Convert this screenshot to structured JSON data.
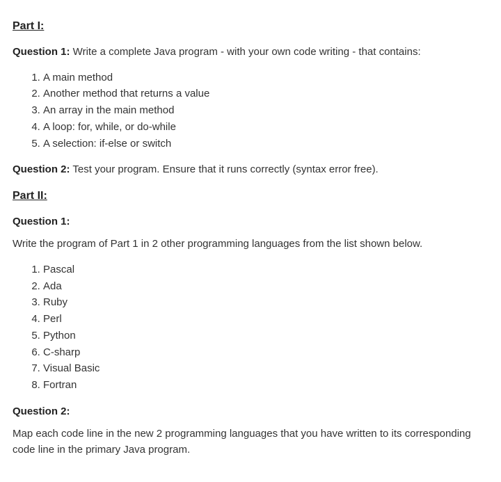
{
  "part1": {
    "heading": "Part I:",
    "q1": {
      "label": "Question 1:",
      "text": " Write a complete Java program - with your own code writing - that contains:",
      "items": [
        "A main method",
        "Another method that returns a value",
        "An array in the main method",
        "A loop: for, while, or do-while",
        "A selection: if-else or switch"
      ]
    },
    "q2": {
      "label": "Question 2:",
      "text": " Test your program. Ensure that it runs correctly (syntax error free)."
    }
  },
  "part2": {
    "heading": "Part II:",
    "q1": {
      "label": "Question 1:",
      "text": "Write the program of Part 1 in 2 other programming languages from the list shown below.",
      "items": [
        "Pascal",
        "Ada",
        "Ruby",
        "Perl",
        "Python",
        "C-sharp",
        "Visual Basic",
        "Fortran"
      ]
    },
    "q2": {
      "label": "Question 2:",
      "text": "Map each code line in the new 2 programming languages that you have written to its corresponding code line in the primary Java program."
    }
  }
}
